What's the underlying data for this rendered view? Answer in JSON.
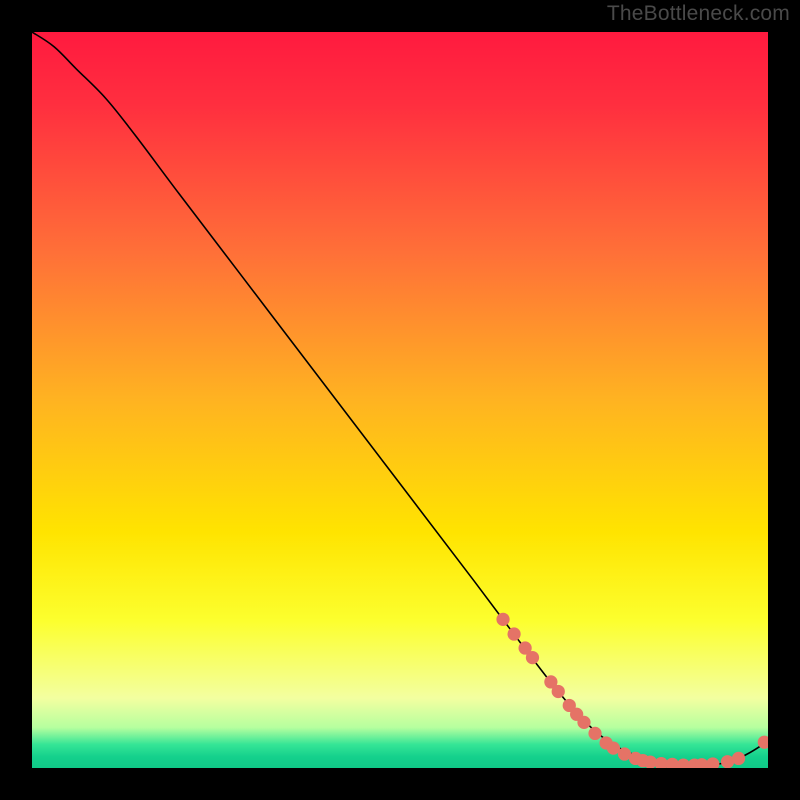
{
  "watermark": "TheBottleneck.com",
  "chart_data": {
    "type": "line",
    "title": "",
    "xlabel": "",
    "ylabel": "",
    "xlim": [
      0,
      100
    ],
    "ylim": [
      0,
      100
    ],
    "grid": false,
    "legend": false,
    "background_gradient": {
      "direction": "vertical",
      "stops": [
        {
          "pos": 0.0,
          "color": "#ff1a3f"
        },
        {
          "pos": 0.1,
          "color": "#ff2f3f"
        },
        {
          "pos": 0.3,
          "color": "#ff7038"
        },
        {
          "pos": 0.5,
          "color": "#ffb321"
        },
        {
          "pos": 0.68,
          "color": "#ffe400"
        },
        {
          "pos": 0.8,
          "color": "#fcff2e"
        },
        {
          "pos": 0.905,
          "color": "#f3ffa0"
        },
        {
          "pos": 0.945,
          "color": "#b6ff9f"
        },
        {
          "pos": 0.968,
          "color": "#35e596"
        },
        {
          "pos": 0.985,
          "color": "#14d08c"
        },
        {
          "pos": 1.0,
          "color": "#10c987"
        }
      ]
    },
    "series": [
      {
        "name": "bottleneck-curve",
        "color": "#000000",
        "x": [
          0,
          3,
          6,
          10,
          14,
          20,
          28,
          36,
          44,
          52,
          60,
          66,
          71,
          74,
          77,
          80,
          83,
          86,
          89,
          92,
          95,
          97,
          99,
          100
        ],
        "y": [
          100,
          98,
          95,
          91,
          86,
          78,
          67.5,
          57,
          46.5,
          36,
          25.5,
          17.5,
          11,
          7.5,
          4.6,
          2.6,
          1.4,
          0.7,
          0.4,
          0.4,
          0.9,
          1.8,
          3.0,
          3.8
        ]
      }
    ],
    "markers": {
      "color": "#e57366",
      "radius_pct": 0.9,
      "points": [
        {
          "x": 64.0,
          "y": 20.2
        },
        {
          "x": 65.5,
          "y": 18.2
        },
        {
          "x": 67.0,
          "y": 16.3
        },
        {
          "x": 68.0,
          "y": 15.0
        },
        {
          "x": 70.5,
          "y": 11.7
        },
        {
          "x": 71.5,
          "y": 10.4
        },
        {
          "x": 73.0,
          "y": 8.5
        },
        {
          "x": 74.0,
          "y": 7.3
        },
        {
          "x": 75.0,
          "y": 6.2
        },
        {
          "x": 76.5,
          "y": 4.7
        },
        {
          "x": 78.0,
          "y": 3.4
        },
        {
          "x": 79.0,
          "y": 2.7
        },
        {
          "x": 80.5,
          "y": 1.9
        },
        {
          "x": 82.0,
          "y": 1.3
        },
        {
          "x": 83.0,
          "y": 1.0
        },
        {
          "x": 84.0,
          "y": 0.8
        },
        {
          "x": 85.5,
          "y": 0.6
        },
        {
          "x": 87.0,
          "y": 0.5
        },
        {
          "x": 88.5,
          "y": 0.4
        },
        {
          "x": 90.0,
          "y": 0.4
        },
        {
          "x": 91.0,
          "y": 0.45
        },
        {
          "x": 92.5,
          "y": 0.55
        },
        {
          "x": 94.5,
          "y": 0.85
        },
        {
          "x": 96.0,
          "y": 1.3
        },
        {
          "x": 99.5,
          "y": 3.5
        }
      ]
    }
  }
}
